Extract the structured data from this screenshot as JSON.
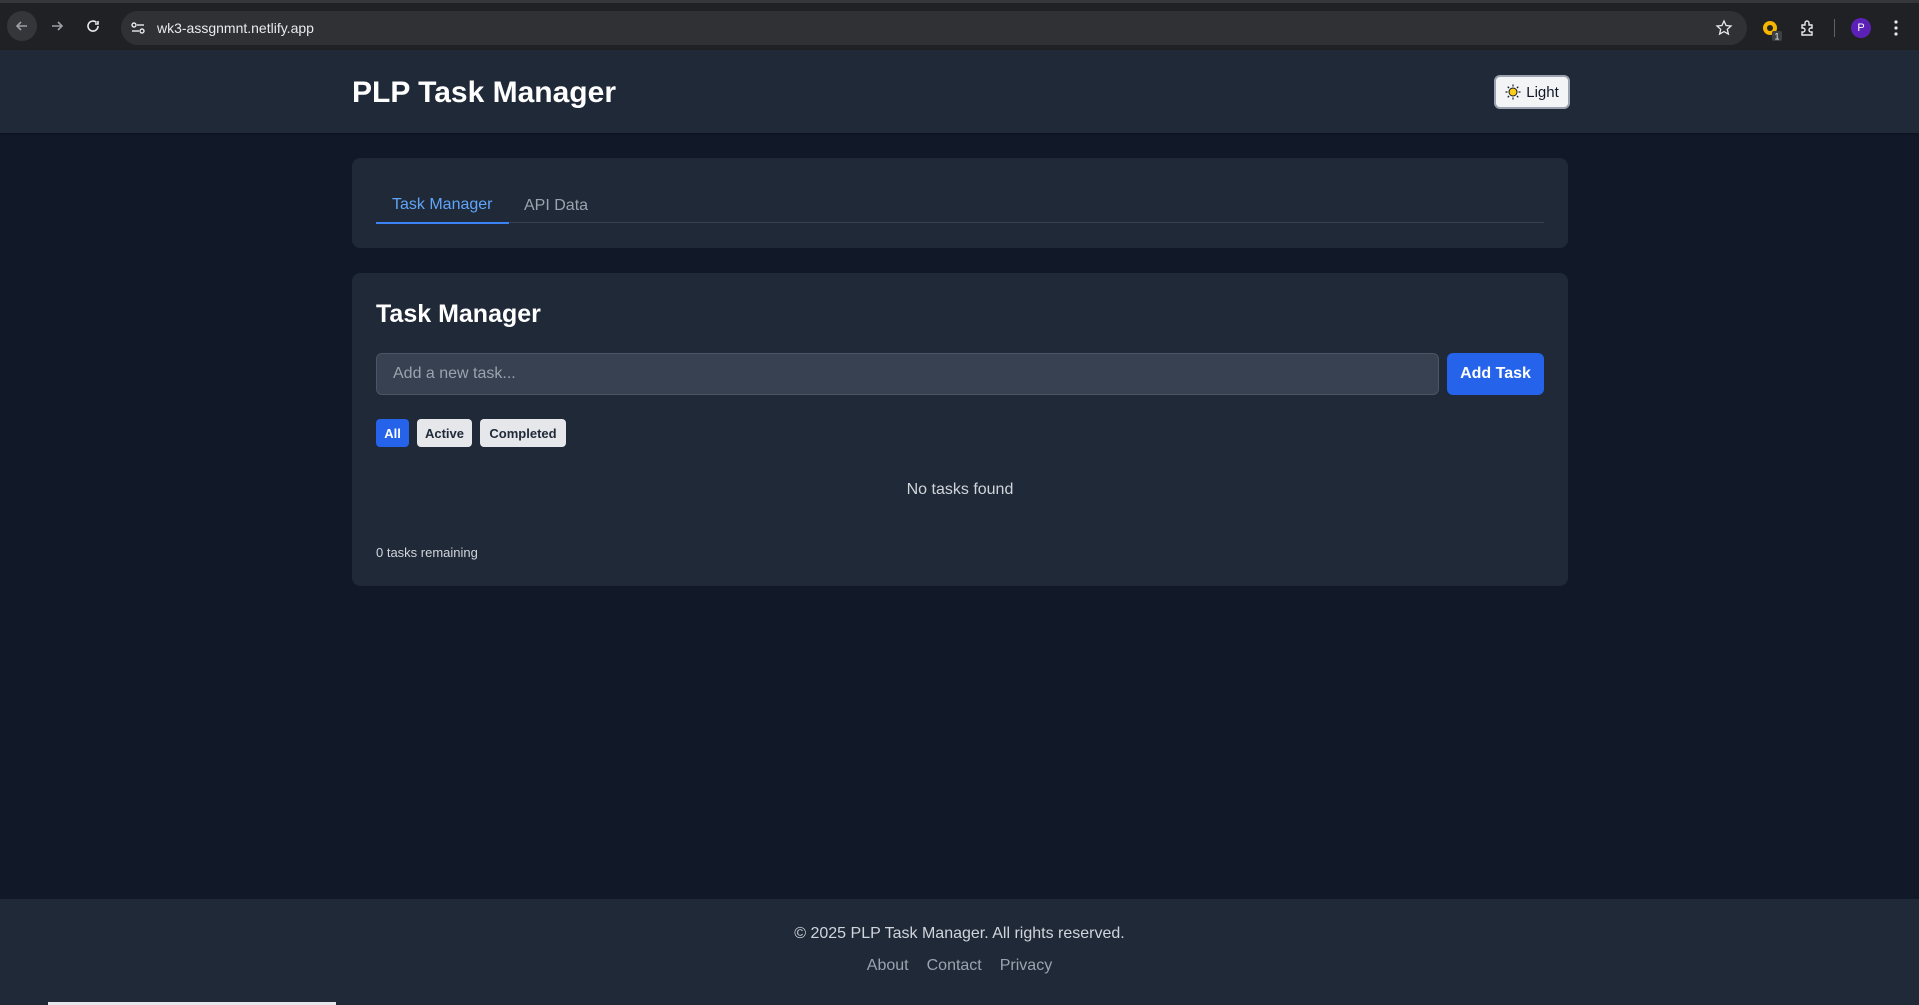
{
  "browser": {
    "url": "wk3-assgnmnt.netlify.app",
    "profile_initial": "P",
    "extension_badge": "1"
  },
  "header": {
    "title": "PLP Task Manager",
    "theme_toggle_label": "Light"
  },
  "tabs": [
    {
      "label": "Task Manager",
      "active": true
    },
    {
      "label": "API Data",
      "active": false
    }
  ],
  "task_manager": {
    "heading": "Task Manager",
    "input_placeholder": "Add a new task...",
    "input_value": "",
    "add_button_label": "Add Task",
    "filters": [
      {
        "label": "All",
        "selected": true
      },
      {
        "label": "Active",
        "selected": false
      },
      {
        "label": "Completed",
        "selected": false
      }
    ],
    "empty_message": "No tasks found",
    "remaining_text": "0 tasks remaining"
  },
  "footer": {
    "copyright": "© 2025 PLP Task Manager. All rights reserved.",
    "links": [
      "About",
      "Contact",
      "Privacy"
    ]
  },
  "colors": {
    "page_bg": "#111827",
    "surface": "#1f2937",
    "accent": "#2563eb",
    "tab_active": "#60a5fa"
  }
}
